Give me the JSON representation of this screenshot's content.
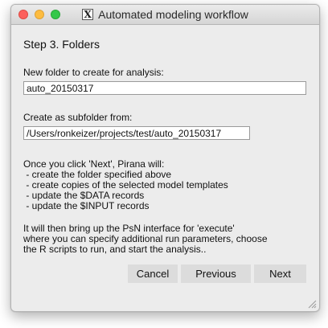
{
  "window": {
    "title": "Automated modeling workflow",
    "controls": [
      "close",
      "minimize",
      "maximize"
    ],
    "app_icon": "x11-icon",
    "app_icon_glyph": "X"
  },
  "step": {
    "title": "Step 3. Folders"
  },
  "form": {
    "new_folder_label": "New folder to create for analysis:",
    "new_folder_value": "auto_20150317",
    "subfolder_label": "Create as subfolder from:",
    "subfolder_value": "/Users/ronkeizer/projects/test/auto_20150317"
  },
  "info": {
    "lines": [
      "Once you click 'Next', Pirana will:",
      " - create the folder specified above",
      " - create copies of the selected model templates",
      " - update the $DATA records",
      " - update the $INPUT records"
    ],
    "followup": [
      "It will then bring up the PsN interface for 'execute'",
      "where you can specify additional run parameters, choose",
      "the R scripts to run, and start the analysis.."
    ]
  },
  "buttons": {
    "cancel": "Cancel",
    "previous": "Previous",
    "next": "Next"
  },
  "colors": {
    "window_bg": "#ececec",
    "button_bg": "#dcdcdc",
    "close": "#fc605c",
    "minimize": "#fdbc40",
    "maximize": "#34c84a"
  }
}
